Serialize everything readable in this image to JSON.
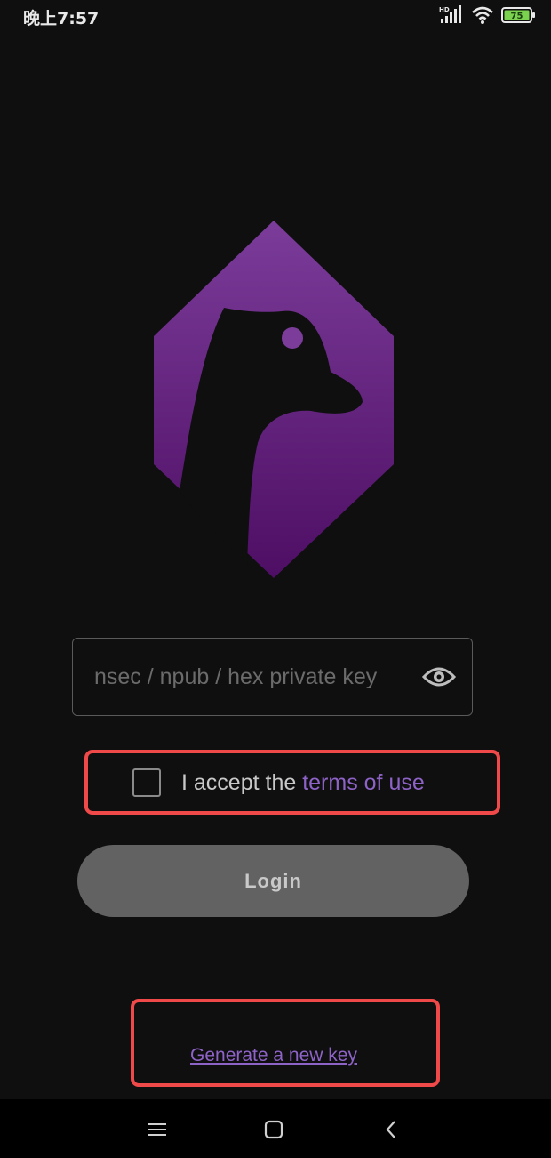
{
  "status_bar": {
    "time": "晚上7:57",
    "network_label": "HD",
    "battery_level": "75",
    "battery_color": "#7ad24f"
  },
  "logo": {
    "name": "goose-logo",
    "gradient_top": "#7b3c9a",
    "gradient_bottom": "#4e0e64"
  },
  "login_form": {
    "key_placeholder": "nsec / npub / hex private key",
    "key_value": "",
    "terms_prefix": "I accept the ",
    "terms_link": "terms of use",
    "terms_checked": false,
    "login_label": "Login",
    "generate_key_label": "Generate a new key"
  },
  "nav_bar": {
    "items": [
      "menu-icon",
      "home-icon",
      "back-icon"
    ]
  },
  "colors": {
    "background": "#0f0f0f",
    "accent": "#8e63c7",
    "highlight": "#ef4949",
    "button": "#626262"
  }
}
